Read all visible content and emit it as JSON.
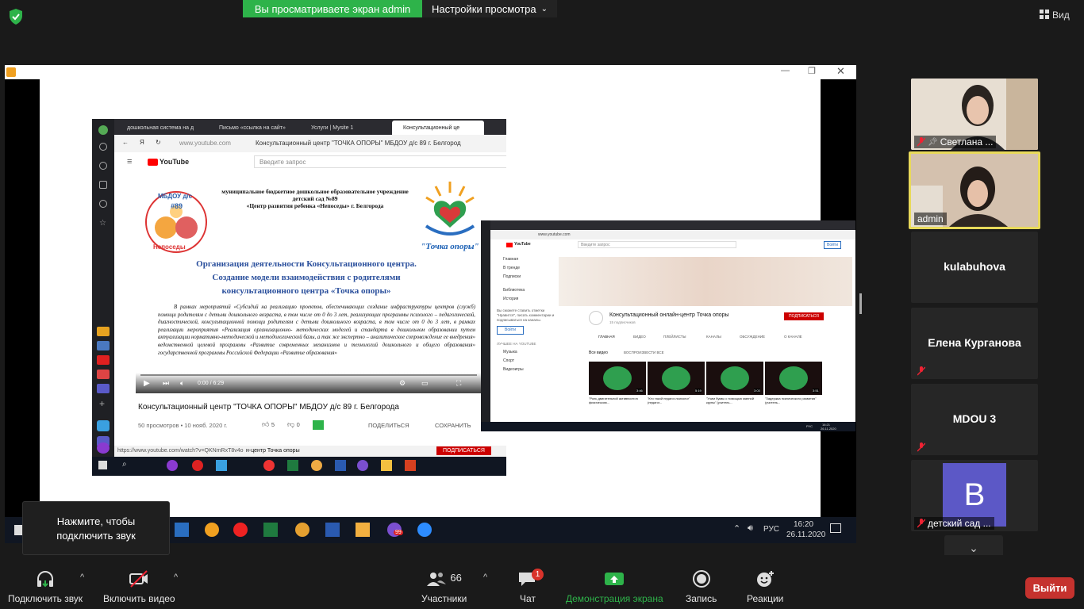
{
  "top": {
    "share_banner": "Вы просматриваете экран admin",
    "view_settings": "Настройки просмотра",
    "view_button": "Вид"
  },
  "shared_screen": {
    "browser_tabs": [
      "дошкольная система на д",
      "Письмо «ссылка на сайт»",
      "Услуги | Mysite 1",
      "Консультационный це"
    ],
    "address_url": "www.youtube.com",
    "page_title": "Консультационный центр \"ТОЧКА ОПОРЫ\" МБДОУ д/с 89 г. Белгород",
    "search_placeholder": "Введите запрос",
    "youtube_label": "YouTube",
    "slide": {
      "org_line1": "муниципальное бюджетное дошкольное образовательное учреждение",
      "org_line2": "детский сад №89",
      "org_line3": "«Центр развития ребенка «Непоседы» г. Белгорода",
      "heading1": "Организация деятельности Консультационного центра.",
      "heading2": "Создание модели взаимодействия с родителями",
      "heading3": "консультационного центра «Точка опоры»",
      "logo_right": "\"Точка опоры\"",
      "logo_left_top": "МБДОУ д/с",
      "logo_left_num": "#89",
      "logo_left_bottom": "Непоседы",
      "body": "В рамках мероприятий «Субсидий на реализацию проектов, обеспечивающих создание инфраструктуры центров (служб) помощи родителям с детьми дошкольного возраста, в том числе от 0 до 3 лет, реализующих программы психолого – педагогической, диагностической, консультационной помощи родителям с детьми дошкольного возраста, в том числе от 0 до 3 лет, в рамках реализации мероприятия «Реализация организационно- методических моделей и стандарта в дошкольном образовании путем актуализации нормативно-методической и методологической базы, а так же экспертно – аналитическое сопровождение ее внедрения» ведомственной целевой программы «Развитие современных механизмов и технологий дошкольного и общего образования» государственной программы Российской Федерации «Развитие образования»"
    },
    "video_time": "0:00 / 6:29",
    "video_title": "Консультационный центр \"ТОЧКА ОПОРЫ\" МБДОУ д/с 89 г. Белгорода",
    "views": "50 просмотров • 10 нояб. 2020 г.",
    "likes": "5",
    "dislikes": "0",
    "share": "ПОДЕЛИТЬСЯ",
    "save": "СОХРАНИТЬ",
    "status_url": "https://www.youtube.com/watch?v=QKNmRxT8v4o",
    "channel_partial": "н-центр Точка опоры",
    "subscribe_partial": "ПОДПИСАТЬСЯ",
    "inner2": {
      "channel_name": "Консультационный онлайн-центр Точка опоры",
      "subscribers": "15 подписчиков",
      "subscribe": "ПОДПИСАТЬСЯ",
      "nav": [
        "ГЛАВНАЯ",
        "ВИДЕО",
        "ПЛЕЙЛИСТЫ",
        "КАНАЛЫ",
        "ОБСУЖДЕНИЕ",
        "О КАНАЛЕ"
      ],
      "all_videos": "Все видео",
      "play_all": "ВОСПРОИЗВЕСТИ ВСЕ",
      "side": [
        "Главная",
        "В тренде",
        "Подписки",
        "Библиотека",
        "История"
      ],
      "login": "Войти",
      "best": "ЛУЧШЕЕ НА YOUTUBE",
      "side2": [
        "Музыка",
        "Спорт",
        "Видеоигры"
      ],
      "videos": [
        {
          "title": "\"Роль двигательной активности в физическом...",
          "dur": "3:46"
        },
        {
          "title": "\"Кто такой педагог-психолог\" (педагог...",
          "dur": "5:19"
        },
        {
          "title": "\"Учим буквы с помощью манной крупы\" (учитель...",
          "dur": "3:03"
        },
        {
          "title": "\"Задержка психического развития\" (учитель...",
          "dur": "3:51"
        }
      ],
      "login_hint": "Вы сможете ставить отметки \"Нравится\", писать комментарии и подписываться на каналы.",
      "time": "16:21",
      "date": "26.11.2020",
      "lang": "РУС"
    }
  },
  "shared_taskbar": {
    "lang": "РУС",
    "time": "16:20",
    "date": "26.11.2020",
    "viber_badge": "99"
  },
  "gallery": [
    {
      "name": "Светлана ...",
      "type": "video",
      "muted": true,
      "pinned": true
    },
    {
      "name": "admin",
      "type": "video",
      "muted": false,
      "active": true
    },
    {
      "name": "kulabuhova",
      "type": "name"
    },
    {
      "name": "Елена Курганова",
      "type": "name",
      "muted": true
    },
    {
      "name": "MDOU 3",
      "type": "name",
      "muted": true
    },
    {
      "name": "детский сад ...",
      "type": "avatar",
      "initial": "B",
      "muted": true
    }
  ],
  "tooltip": {
    "line1": "Нажмите, чтобы",
    "line2": "подключить звук"
  },
  "toolbar": {
    "audio": "Подключить звук",
    "video": "Включить видео",
    "participants": "Участники",
    "participants_count": "66",
    "chat": "Чат",
    "chat_badge": "1",
    "share": "Демонстрация экрана",
    "record": "Запись",
    "reactions": "Реакции",
    "leave": "Выйти"
  },
  "colors": {
    "share_green": "#2eb34a",
    "leave_red": "#c5322e",
    "active_border": "#e8d95a",
    "avatar_purple": "#5c58c6"
  }
}
